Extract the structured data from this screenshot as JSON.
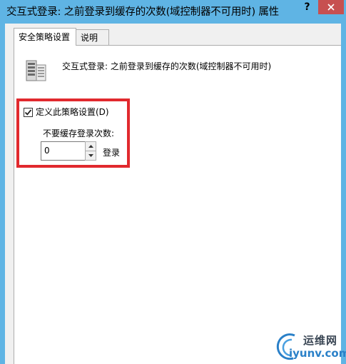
{
  "window": {
    "title": "交互式登录: 之前登录到缓存的次数(域控制器不可用时) 属性",
    "help_label": "?",
    "titlebar_color": "#5fb4e4",
    "close_color": "#c75050"
  },
  "tabs": [
    {
      "label": "安全策略设置",
      "active": true
    },
    {
      "label": "说明",
      "active": false
    }
  ],
  "policy": {
    "icon": "server-policy-icon",
    "title": "交互式登录: 之前登录到缓存的次数(域控制器不可用时)"
  },
  "define_setting": {
    "label": "定义此策略设置(D)",
    "checked": true
  },
  "cache": {
    "label": "不要缓存登录次数:",
    "value": "0",
    "unit": "登录"
  },
  "highlight_color": "#e1292e",
  "watermark": {
    "name_cn": "运维网",
    "domain": "iyunv.com"
  }
}
